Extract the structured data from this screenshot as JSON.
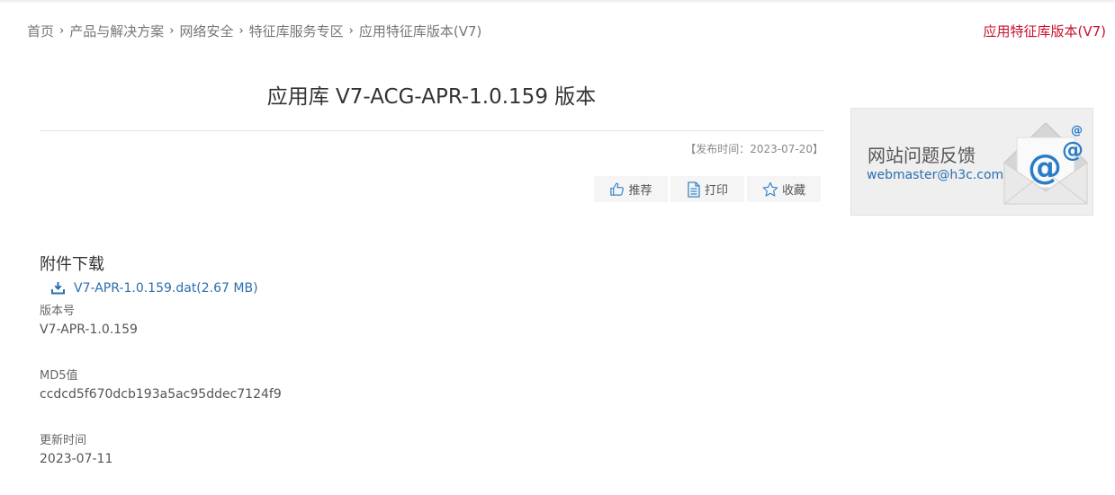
{
  "breadcrumb": {
    "items": [
      "首页",
      "产品与解决方案",
      "网络安全",
      "特征库服务专区",
      "应用特征库版本(V7)"
    ],
    "separator": "›"
  },
  "section_title": "应用特征库版本(V7)",
  "article": {
    "title": "应用库 V7-ACG-APR-1.0.159 版本",
    "pubdate": "【发布时间：2023-07-20】"
  },
  "actions": {
    "recommend": "推荐",
    "print": "打印",
    "favorite": "收藏"
  },
  "feedback": {
    "title": "网站问题反馈",
    "email": "webmaster@h3c.com"
  },
  "downloads": {
    "heading": "附件下载",
    "file_label": "V7-APR-1.0.159.dat(2.67 MB)"
  },
  "fields": {
    "version_label": "版本号",
    "version_value": "V7-APR-1.0.159",
    "md5_label": "MD5值",
    "md5_value": "ccdcd5f670dcb193a5ac95ddec7124f9",
    "updated_label": "更新时间",
    "updated_value": "2023-07-11"
  },
  "colors": {
    "brand_red": "#c8102e",
    "link_blue": "#2a6fb0",
    "icon_blue": "#3a86c8"
  },
  "icons": [
    "thumbs-up-icon",
    "document-icon",
    "star-icon",
    "download-icon",
    "email-envelope-icon"
  ]
}
